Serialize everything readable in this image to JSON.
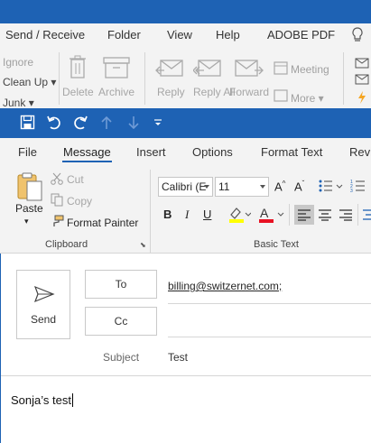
{
  "main_window": {
    "menu": [
      "Send / Receive",
      "Folder",
      "View",
      "Help",
      "ADOBE PDF"
    ],
    "ribbon": {
      "ignore": "Ignore",
      "clean_up": "Clean Up",
      "junk": "Junk",
      "delete": "Delete",
      "archive": "Archive",
      "reply": "Reply",
      "reply_all": "Reply All",
      "forward": "Forward",
      "meeting": "Meeting",
      "more": "More"
    }
  },
  "compose": {
    "tabs": [
      "File",
      "Message",
      "Insert",
      "Options",
      "Format Text",
      "Revi"
    ],
    "active_tab": "Message",
    "clipboard": {
      "paste": "Paste",
      "cut": "Cut",
      "copy": "Copy",
      "format_painter": "Format Painter",
      "group_label": "Clipboard"
    },
    "basic_text": {
      "font_name": "Calibri (E",
      "font_size": "11",
      "group_label": "Basic Text",
      "bold": "B",
      "italic": "I",
      "underline": "U"
    },
    "header": {
      "send_label": "Send",
      "to_label": "To",
      "cc_label": "Cc",
      "subject_label": "Subject",
      "to_value": "billing@switzernet.com;",
      "cc_value": "",
      "subject_value": "Test"
    },
    "body_text": "Sonja’s test"
  },
  "colors": {
    "accent": "#1e62b4",
    "ribbon_bg": "#f3f3f3",
    "highlight_yellow": "#ffff00",
    "font_red": "#e81123"
  }
}
